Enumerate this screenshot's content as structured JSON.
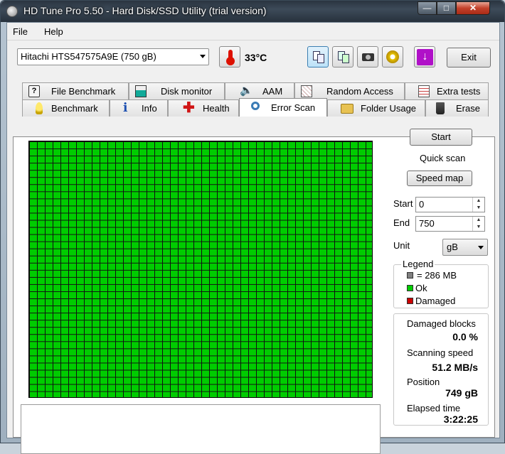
{
  "window": {
    "title": "HD Tune Pro 5.50 - Hard Disk/SSD Utility (trial version)"
  },
  "menu": {
    "file": "File",
    "help": "Help"
  },
  "toolbar": {
    "drive": "Hitachi HTS547575A9E (750 gB)",
    "temperature": "33°C",
    "exit_label": "Exit"
  },
  "tabs_top": [
    {
      "label": "File Benchmark",
      "icon": "file-benchmark-icon"
    },
    {
      "label": "Disk monitor",
      "icon": "disk-monitor-icon"
    },
    {
      "label": "AAM",
      "icon": "speaker-icon"
    },
    {
      "label": "Random Access",
      "icon": "random-access-icon"
    },
    {
      "label": "Extra tests",
      "icon": "extra-tests-icon"
    }
  ],
  "tabs_bottom": [
    {
      "label": "Benchmark",
      "icon": "lightbulb-icon"
    },
    {
      "label": "Info",
      "icon": "info-icon"
    },
    {
      "label": "Health",
      "icon": "health-cross-icon"
    },
    {
      "label": "Error Scan",
      "icon": "magnifier-icon",
      "active": true
    },
    {
      "label": "Folder Usage",
      "icon": "folder-icon"
    },
    {
      "label": "Erase",
      "icon": "trash-icon"
    }
  ],
  "scan": {
    "start_label": "Start",
    "quick_scan_label": "Quick scan",
    "speed_map_label": "Speed map",
    "start_field_label": "Start",
    "start_value": "0",
    "end_field_label": "End",
    "end_value": "750",
    "unit_label": "Unit",
    "unit_value": "gB"
  },
  "legend": {
    "title": "Legend",
    "block_size": "= 286 MB",
    "ok": "Ok",
    "damaged": "Damaged",
    "colors": {
      "block": "#808080",
      "ok": "#00cc00",
      "damaged": "#cc0000"
    }
  },
  "stats": {
    "damaged_blocks_label": "Damaged blocks",
    "damaged_blocks_value": "0.0 %",
    "scanning_speed_label": "Scanning speed",
    "scanning_speed_value": "51.2 MB/s",
    "position_label": "Position",
    "position_value": "749 gB",
    "elapsed_label": "Elapsed time",
    "elapsed_value": "3:22:25"
  }
}
